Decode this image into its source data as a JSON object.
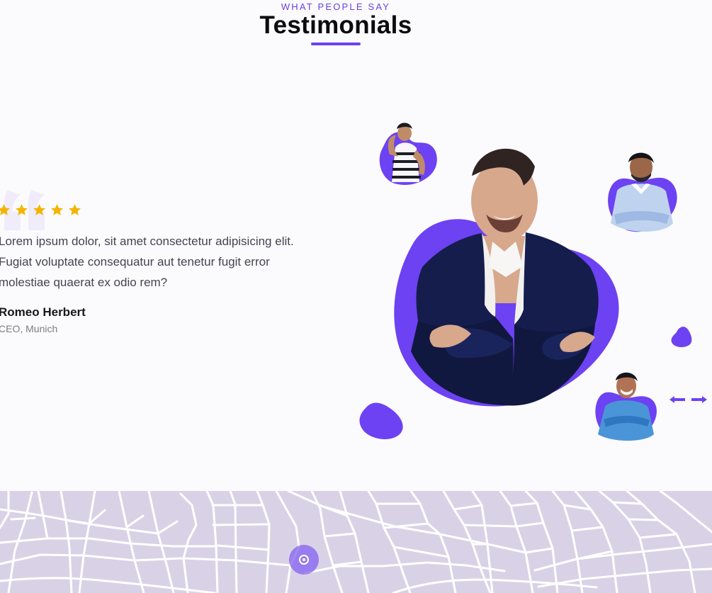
{
  "section": {
    "eyebrow": "WHAT PEOPLE SAY",
    "title": "Testimonials"
  },
  "testimonial": {
    "stars": 5,
    "quote": "Lorem ipsum dolor, sit amet consectetur adipisicing elit. Fugiat voluptate consequatur aut tenetur fugit error molestiae quaerat ex odio rem?",
    "name": "Romeo Herbert",
    "role": "CEO, Munich"
  },
  "colors": {
    "accent": "#6d42f2",
    "star": "#f4b400",
    "map_background": "#d9d2e6"
  },
  "icons": {
    "quote": "quote-mark-icon",
    "star": "star-icon",
    "prev": "arrow-left-icon",
    "next": "arrow-right-icon",
    "map_marker": "map-marker-icon"
  }
}
